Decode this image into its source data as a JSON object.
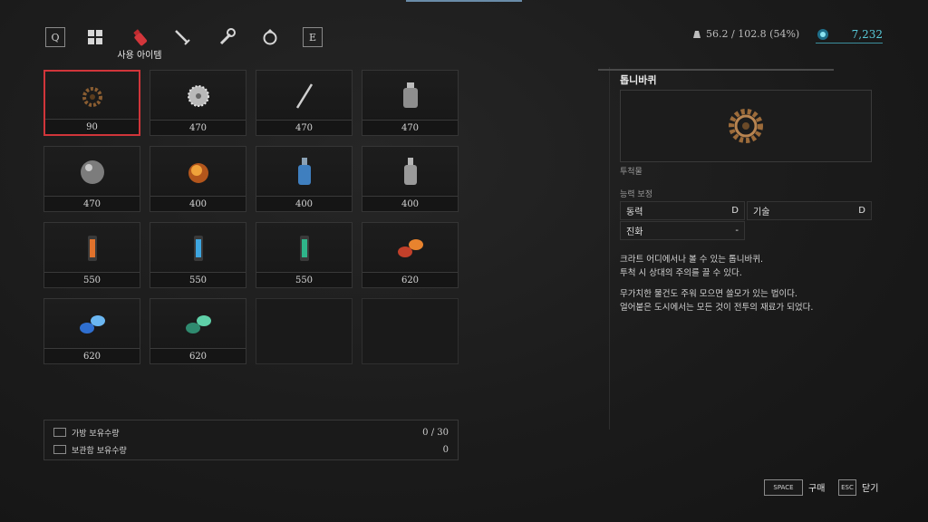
{
  "categories": {
    "q_key": "Q",
    "e_key": "E",
    "active_label": "사용 아이템",
    "icons": [
      "grid-icon",
      "potion-icon",
      "dagger-icon",
      "wrench-icon",
      "ring-icon"
    ]
  },
  "status": {
    "weight": "56.2 / 102.8 (54%)",
    "currency": "7,232",
    "accent": "#58c9d8"
  },
  "items": [
    {
      "price": "90",
      "icon": "cog-icon",
      "selected": true
    },
    {
      "price": "470",
      "icon": "sawblade-icon"
    },
    {
      "price": "470",
      "icon": "throwing-spear-icon"
    },
    {
      "price": "470",
      "icon": "bottle-icon"
    },
    {
      "price": "470",
      "icon": "iron-ball-icon"
    },
    {
      "price": "400",
      "icon": "fire-flask-icon"
    },
    {
      "price": "400",
      "icon": "blue-flask-icon"
    },
    {
      "price": "400",
      "icon": "gray-flask-icon"
    },
    {
      "price": "550",
      "icon": "orange-cartridge-icon"
    },
    {
      "price": "550",
      "icon": "blue-cartridge-icon"
    },
    {
      "price": "550",
      "icon": "green-cartridge-icon"
    },
    {
      "price": "620",
      "icon": "fire-grinder-icon"
    },
    {
      "price": "620",
      "icon": "electric-grinder-icon"
    },
    {
      "price": "620",
      "icon": "acid-grinder-icon"
    },
    {
      "price": "",
      "icon": ""
    },
    {
      "price": "",
      "icon": ""
    }
  ],
  "holdings": {
    "bag_label": "가방 보유수량",
    "bag_value": "0 / 30",
    "storage_label": "보관함 보유수량",
    "storage_value": "0"
  },
  "detail": {
    "name": "톱니바퀴",
    "category": "투척물",
    "stat_section": "능력 보정",
    "stats": [
      {
        "name": "동력",
        "grade": "D"
      },
      {
        "name": "기술",
        "grade": "D"
      },
      {
        "name": "진화",
        "grade": "-"
      }
    ],
    "desc1": [
      "크라트 어디에서나 볼 수 있는 톱니바퀴.",
      "투척 시 상대의 주의를 끌 수 있다."
    ],
    "desc2": [
      "무가치한 물건도 주워 모으면 쓸모가 있는 법이다.",
      "얼어붙은 도시에서는 모든 것이 전투의 재료가 되었다."
    ]
  },
  "actions": {
    "space_key": "SPACE",
    "buy_label": "구매",
    "esc_key": "ESC",
    "close_label": "닫기"
  }
}
